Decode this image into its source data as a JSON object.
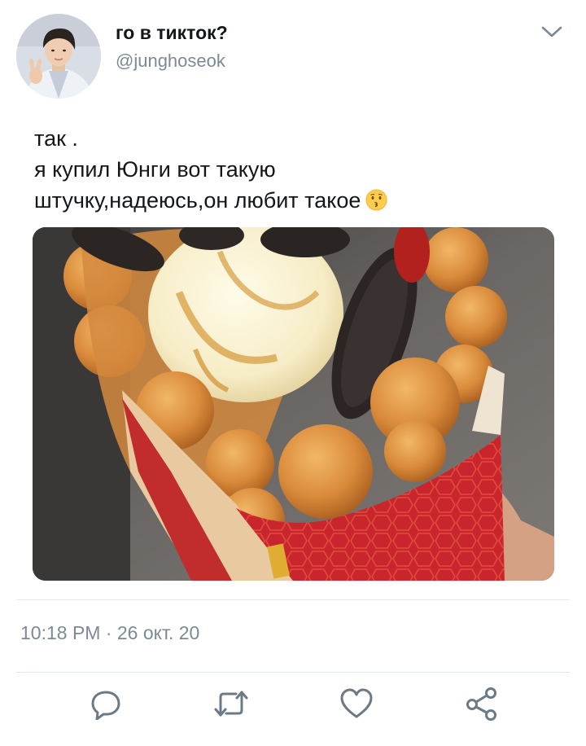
{
  "tweet": {
    "display_name": "го в тикток?",
    "handle": "@junghoseok",
    "text_lines": [
      "так .",
      "я купил Юнги вот такую",
      "штучку,надеюсь,он любит такое"
    ],
    "emoji": "kissing-face-emoji",
    "timestamp": "10:18 PM · 26 окт. 20"
  },
  "colors": {
    "secondary_text": "#7b8a96",
    "icon": "#6b7a86",
    "divider": "#e1e8ed"
  },
  "icons": {
    "more": "chevron-down-icon",
    "reply": "reply-icon",
    "retweet": "retweet-icon",
    "like": "heart-icon",
    "share": "share-icon"
  }
}
